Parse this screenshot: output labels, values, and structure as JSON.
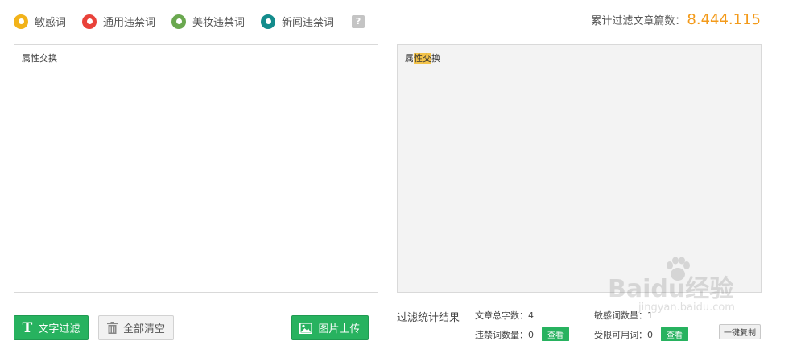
{
  "legend": [
    {
      "label": "敏感词",
      "color": "#f2b31a",
      "icon": "sensitive-word-dot"
    },
    {
      "label": "通用违禁词",
      "color": "#e9423a",
      "icon": "general-banned-dot"
    },
    {
      "label": "美妆违禁词",
      "color": "#6aa84f",
      "icon": "cosmetics-banned-dot"
    },
    {
      "label": "新闻违禁词",
      "color": "#138c8c",
      "icon": "news-banned-dot"
    }
  ],
  "help_icon": "?",
  "counter": {
    "label": "累计过滤文章篇数：",
    "value": "8.444.115"
  },
  "input_panel": {
    "text": "属性交换"
  },
  "output_panel": {
    "pre": "属",
    "highlight": "性交",
    "post": "换"
  },
  "buttons": {
    "filter": "文字过滤",
    "clear": "全部清空",
    "upload": "图片上传",
    "copy": "一键复制",
    "view": "查看"
  },
  "stats": {
    "title": "过滤统计结果",
    "total_words": "文章总字数：4",
    "sensitive_count": "敏感词数量：1",
    "banned_count": "违禁词数量：0",
    "restricted_count": "受限可用词：0"
  },
  "watermark": {
    "brand": "Bai",
    "brand2": "du",
    "brand3": "经验",
    "url": "jingyan.baidu.com"
  },
  "colors": {
    "accent_green": "#27b25f",
    "counter_orange": "#f39a1a",
    "highlight": "#f3c34a"
  }
}
